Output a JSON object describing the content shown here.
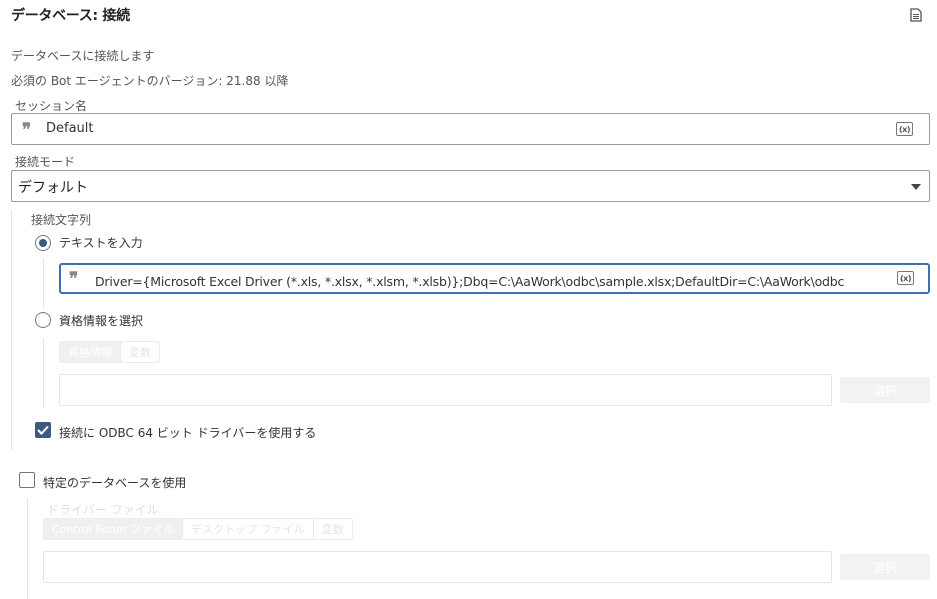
{
  "header": {
    "title": "データベース: 接続",
    "description": "データベースに接続します",
    "requirement": "必須の Bot エージェントのバージョン: 21.88 以降"
  },
  "session": {
    "label": "セッション名",
    "value": "Default",
    "var_badge": "(x)"
  },
  "mode": {
    "label": "接続モード",
    "value": "デフォルト"
  },
  "connection_string": {
    "label": "接続文字列",
    "option_text": "テキストを入力",
    "option_text_selected": true,
    "value": "Driver={Microsoft Excel Driver (*.xls, *.xlsx, *.xlsm, *.xlsb)};Dbq=C:\\AaWork\\odbc\\sample.xlsx;DefaultDir=C:\\AaWork\\odbc",
    "var_badge": "(x)",
    "option_credential": "資格情報を選択",
    "credential_tabs": [
      "資格情報",
      "変数"
    ],
    "select_button": "選択",
    "odbc64_label": "接続に ODBC 64 ビット ドライバーを使用する",
    "odbc64_checked": true
  },
  "specific_db": {
    "label": "特定のデータベースを使用",
    "checked": false,
    "driver_label": "ドライバー ファイル",
    "driver_tabs": [
      "Control Room ファイル",
      "デスクトップ ファイル",
      "変数"
    ],
    "select_button": "選択"
  },
  "colors": {
    "accent": "#3c5a80",
    "focus_border": "#3d6fb6"
  }
}
